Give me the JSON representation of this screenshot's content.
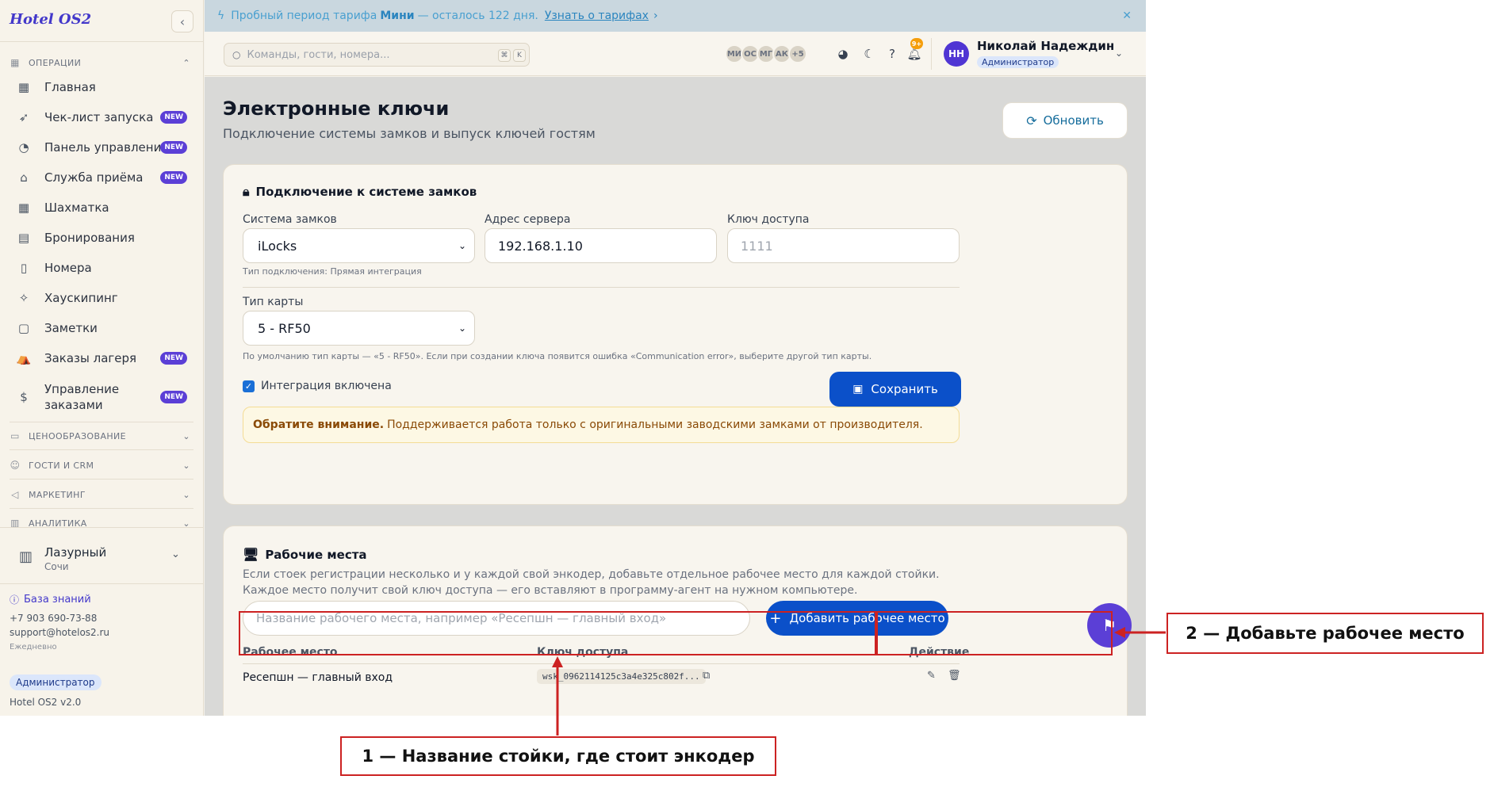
{
  "app": {
    "logo": "Hotel OS2"
  },
  "banner": {
    "text_before": "Пробный период тарифа",
    "plan": "Мини",
    "text_after": "— осталось 122 дня.",
    "link": "Узнать о тарифах"
  },
  "search": {
    "placeholder": "Команды, гости, номера...",
    "kbd1": "⌘",
    "kbd2": "K"
  },
  "presence": {
    "avatars": [
      "МИ",
      "ОС",
      "МГ",
      "АК"
    ],
    "more": "+5"
  },
  "notifications": {
    "badge": "9+"
  },
  "user": {
    "initials": "НН",
    "name": "Николай Надеждин",
    "role": "Администратор"
  },
  "sidebar": {
    "section_operations": "Операции",
    "items": [
      {
        "label": "Главная",
        "icon": "dashboard-icon",
        "new": false
      },
      {
        "label": "Чек-лист запуска",
        "icon": "rocket-icon",
        "new": true
      },
      {
        "label": "Панель управления",
        "icon": "gauge-icon",
        "new": true
      },
      {
        "label": "Служба приёма",
        "icon": "bell-icon",
        "new": true
      },
      {
        "label": "Шахматка",
        "icon": "grid-icon",
        "new": false
      },
      {
        "label": "Бронирования",
        "icon": "clipboard-icon",
        "new": false
      },
      {
        "label": "Номера",
        "icon": "door-icon",
        "new": false
      },
      {
        "label": "Хаускипинг",
        "icon": "sparkle-icon",
        "new": false
      },
      {
        "label": "Заметки",
        "icon": "note-icon",
        "new": false
      },
      {
        "label": "Заказы лагеря",
        "icon": "tent-icon",
        "new": true
      },
      {
        "label": "Управление заказами",
        "icon": "dollar-icon",
        "new": true
      }
    ],
    "new_badge": "NEW",
    "sections": [
      "Ценообразование",
      "Гости и CRM",
      "Маркетинг",
      "Аналитика"
    ],
    "hotel": {
      "name": "Лазурный",
      "city": "Сочи"
    },
    "knowledge_base": "База знаний",
    "phone": "+7 903 690-73-88",
    "email": "support@hotelos2.ru",
    "hours": "Ежедневно",
    "role": "Администратор",
    "version": "Hotel OS2 v2.0"
  },
  "page": {
    "title": "Электронные ключи",
    "subtitle": "Подключение системы замков и выпуск ключей гостям",
    "refresh": "Обновить"
  },
  "lock_card": {
    "title": "Подключение к системе замков",
    "system_label": "Система замков",
    "system_value": "iLocks",
    "connection_hint": "Тип подключения: Прямая интеграция",
    "server_label": "Адрес сервера",
    "server_value": "192.168.1.10",
    "key_label": "Ключ доступа",
    "key_placeholder": "1111",
    "card_type_label": "Тип карты",
    "card_type_value": "5 - RF50",
    "card_hint": "По умолчанию тип карты — «5 - RF50». Если при создании ключа появится ошибка «Communication error», выберите другой тип карты.",
    "integration_label": "Интеграция включена",
    "save": "Сохранить",
    "alert_bold": "Обратите внимание.",
    "alert_text": "Поддерживается работа только с оригинальными заводскими замками от производителя."
  },
  "workplaces": {
    "title": "Рабочие места",
    "description": "Если стоек регистрации несколько и у каждой свой энкодер, добавьте отдельное рабочее место для каждой стойки. Каждое место получит свой ключ доступа — его вставляют в программу-агент на нужном компьютере.",
    "input_placeholder": "Название рабочего места, например «Ресепшн — главный вход»",
    "add": "Добавить рабочее место",
    "columns": [
      "Рабочее место",
      "Ключ доступа",
      "Действие"
    ],
    "rows": [
      {
        "name": "Ресепшн — главный вход",
        "key": "wsk_0962114125c3a4e325c802f..."
      }
    ]
  },
  "annotations": {
    "label1": "1 — Название стойки, где стоит энкодер",
    "label2": "2 — Добавьте рабочее место"
  },
  "colors": {
    "accent": "#0b50c9",
    "brand": "#4338ca",
    "badge": "#5b3fd6",
    "annotation": "#cc2222"
  }
}
